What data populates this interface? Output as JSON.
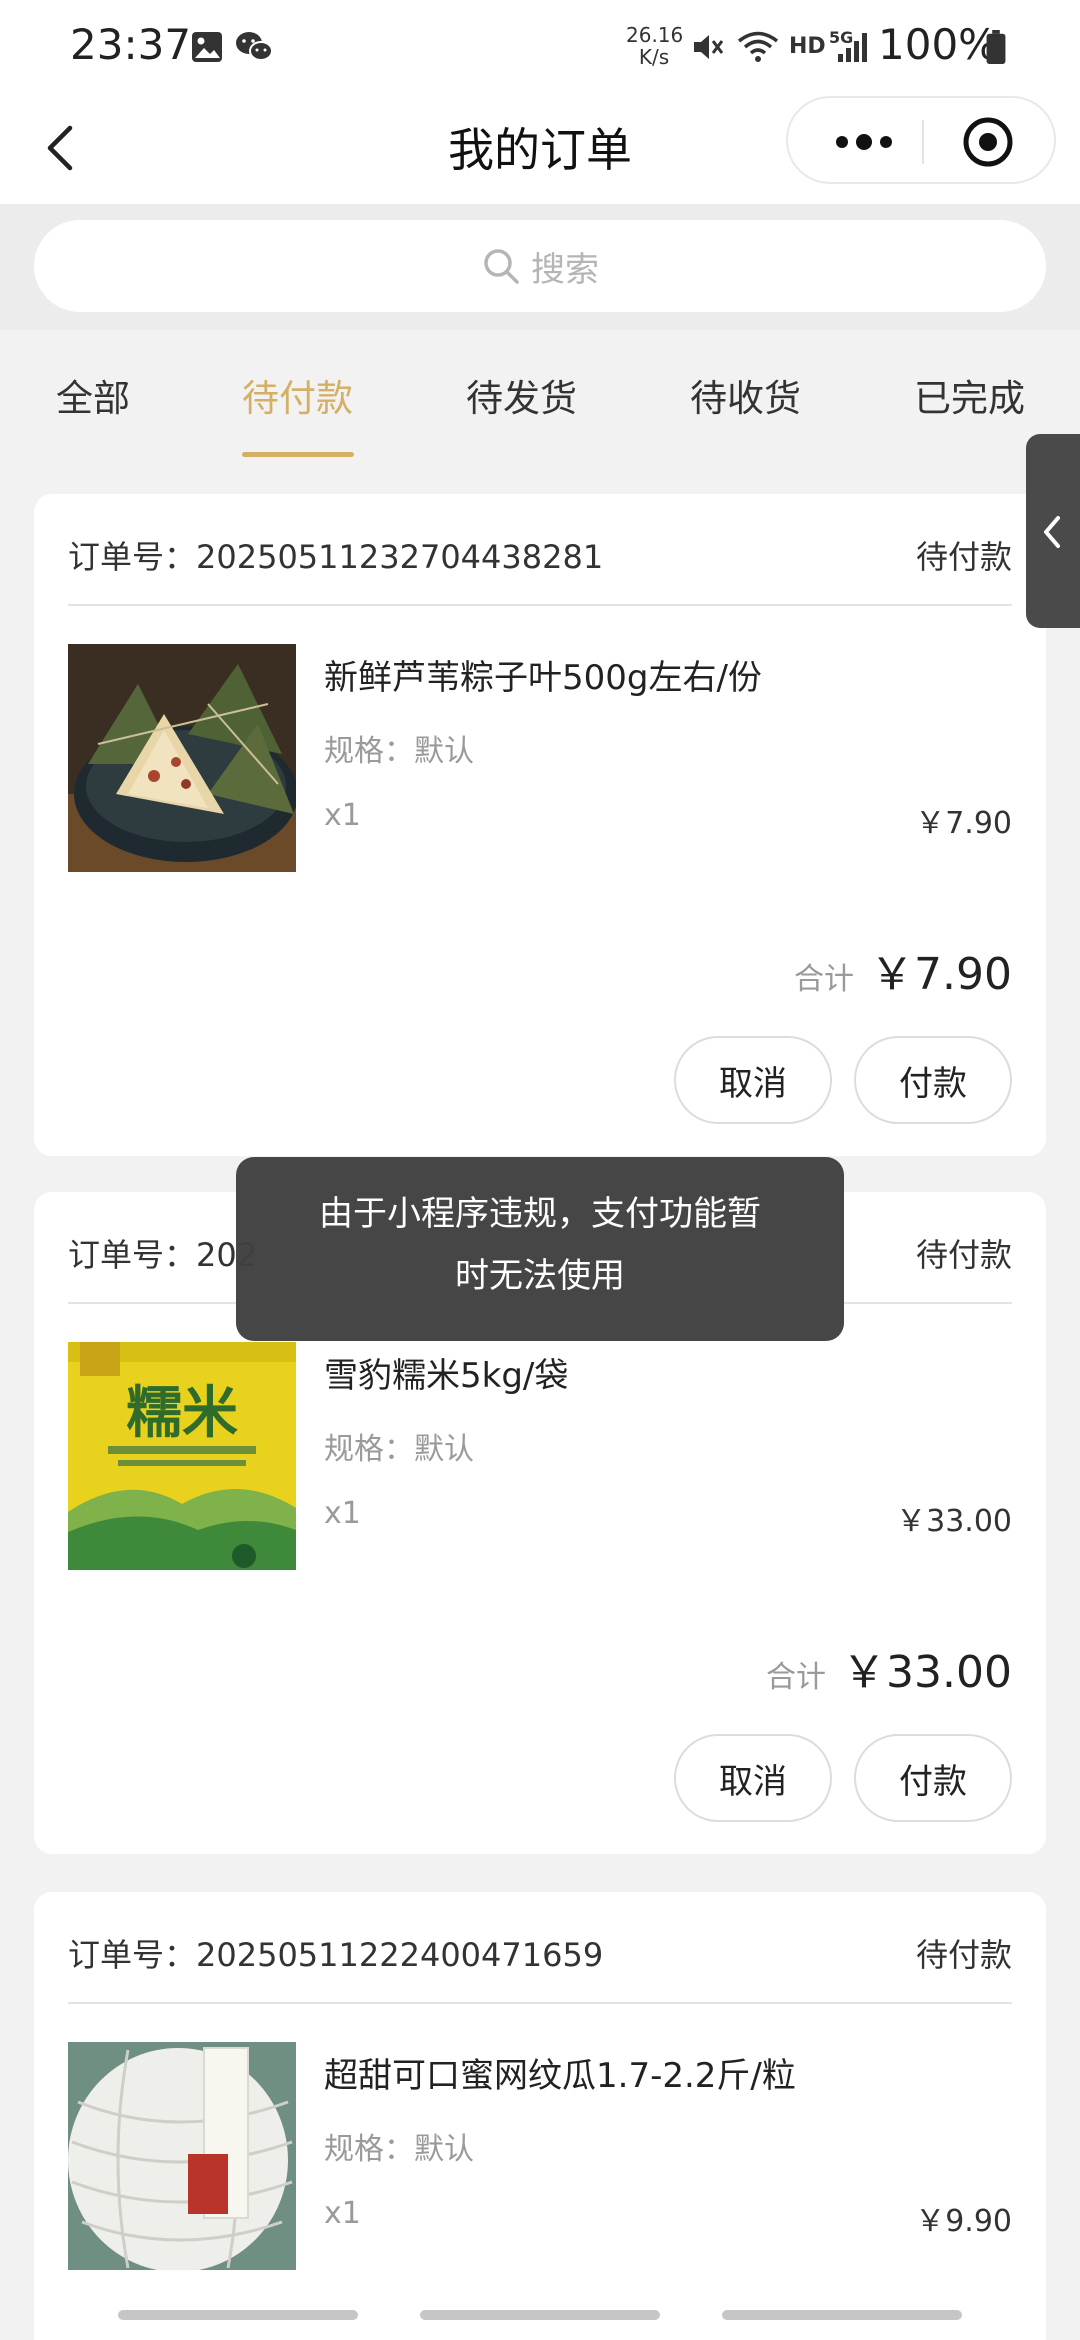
{
  "status_bar": {
    "time": "23:37",
    "net_speed_value": "26.16",
    "net_speed_unit": "K/s",
    "hd": "HD",
    "network": "5G",
    "battery": "100%"
  },
  "nav": {
    "title": "我的订单"
  },
  "search": {
    "placeholder": "搜索"
  },
  "tabs": [
    {
      "label": "全部"
    },
    {
      "label": "待付款"
    },
    {
      "label": "待发货"
    },
    {
      "label": "待收货"
    },
    {
      "label": "已完成"
    }
  ],
  "active_tab": "待付款",
  "accent_color": "#d4b064",
  "orders": [
    {
      "order_label": "订单号：20250511232704438281",
      "status": "待付款",
      "product_name": "新鲜芦苇粽子叶500g左右/份",
      "spec": "规格：默认",
      "qty": "x1",
      "price": "￥7.90",
      "total_label": "合计",
      "total": "￥7.90",
      "cancel_label": "取消",
      "pay_label": "付款"
    },
    {
      "order_label": "订单号：202",
      "status": "待付款",
      "product_name": "雪豹糯米5kg/袋",
      "image_text": "糯米",
      "spec": "规格：默认",
      "qty": "x1",
      "price": "￥33.00",
      "total_label": "合计",
      "total": "￥33.00",
      "cancel_label": "取消",
      "pay_label": "付款"
    },
    {
      "order_label": "订单号：20250511222400471659",
      "status": "待付款",
      "product_name": "超甜可口蜜网纹瓜1.7-2.2斤/粒",
      "spec": "规格：默认",
      "qty": "x1",
      "price": "￥9.90"
    }
  ],
  "toast": {
    "line1": "由于小程序违规，支付功能暂",
    "line2": "时无法使用"
  }
}
